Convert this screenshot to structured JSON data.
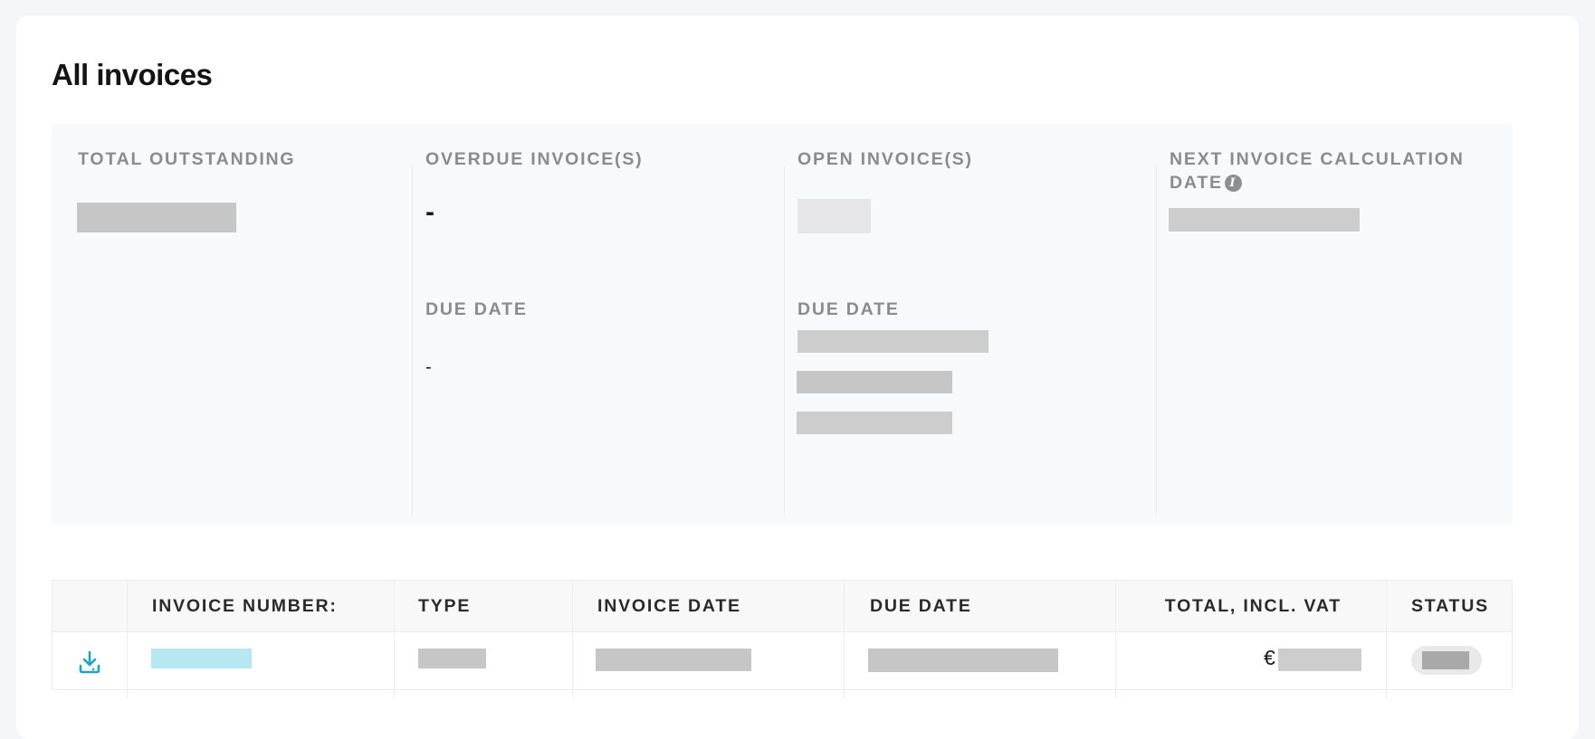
{
  "page": {
    "title": "All invoices"
  },
  "summary": {
    "total_outstanding": {
      "label": "TOTAL OUTSTANDING",
      "value": ""
    },
    "overdue": {
      "label": "OVERDUE INVOICE(S)",
      "value": "-",
      "due_label": "DUE DATE",
      "due_value": "-"
    },
    "open": {
      "label": "OPEN INVOICE(S)",
      "due_label": "DUE DATE"
    },
    "next_calc": {
      "label_line1": "NEXT INVOICE CALCULATION",
      "label_line2": "DATE",
      "info_icon": "info-icon"
    }
  },
  "table": {
    "columns": {
      "invoice_number": "INVOICE NUMBER:",
      "type": "TYPE",
      "invoice_date": "INVOICE DATE",
      "due_date": "DUE DATE",
      "total": "TOTAL, INCL. VAT",
      "status": "STATUS"
    },
    "rows": [
      {
        "currency": "€",
        "icon": "download-icon"
      }
    ]
  },
  "colors": {
    "accent": "#1aa6c8",
    "label": "#8a8b8d",
    "panel": "#f8f9fb"
  }
}
